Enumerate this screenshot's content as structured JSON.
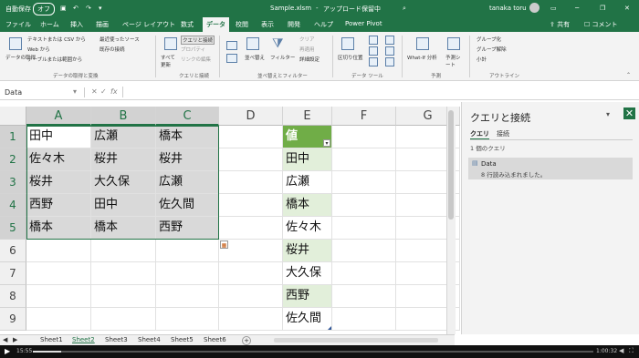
{
  "titlebar": {
    "autosave_label": "自動保存",
    "autosave_state": "オフ",
    "filename": "Sample.xlsm",
    "status": "アップロード保留中",
    "user": "tanaka toru"
  },
  "tabs": [
    "ファイル",
    "ホーム",
    "挿入",
    "描画",
    "ページ レイアウト",
    "数式",
    "データ",
    "校閲",
    "表示",
    "開発",
    "ヘルプ",
    "Power Pivot"
  ],
  "active_tab": "データ",
  "share_label": "共有",
  "comment_label": "コメント",
  "ribbon": {
    "get_data_label": "データの取得",
    "get_data_items": [
      "テキストまたは CSV から",
      "Web から",
      "テーブルまたは範囲から"
    ],
    "recent_items": [
      "最近使ったソース",
      "既存の接続"
    ],
    "group_get": "データの取得と変換",
    "refresh_label": "すべて更新",
    "conn_items": [
      "クエリと接続",
      "プロパティ",
      "リンクの編集"
    ],
    "group_query": "クエリと接続",
    "sort_label": "並べ替え",
    "filter_label": "フィルター",
    "filter_items": [
      "クリア",
      "再適用",
      "詳細設定"
    ],
    "group_sort": "並べ替えとフィルター",
    "split_label": "区切り位置",
    "group_tools": "データ ツール",
    "whatif_label": "What-If 分析",
    "forecast_label": "予測シート",
    "group_forecast": "予測",
    "outline_items": [
      "グループ化",
      "グループ解除",
      "小計"
    ],
    "group_outline": "アウトライン"
  },
  "namebox": "Data",
  "fx_label": "fx",
  "columns": [
    "A",
    "B",
    "C",
    "D",
    "E",
    "F",
    "G"
  ],
  "rows": [
    "1",
    "2",
    "3",
    "4",
    "5",
    "6",
    "7",
    "8",
    "9"
  ],
  "cells": {
    "A": [
      "田中",
      "佐々木",
      "桜井",
      "西野",
      "橋本"
    ],
    "B": [
      "広瀬",
      "桜井",
      "大久保",
      "田中",
      "橋本"
    ],
    "C": [
      "橋本",
      "桜井",
      "広瀬",
      "佐久間",
      "西野"
    ],
    "E": [
      "値",
      "田中",
      "広瀬",
      "橋本",
      "佐々木",
      "桜井",
      "大久保",
      "西野",
      "佐久間"
    ]
  },
  "sheets": [
    "Sheet1",
    "Sheet2",
    "Sheet3",
    "Sheet4",
    "Sheet5",
    "Sheet6"
  ],
  "active_sheet": "Sheet2",
  "pane": {
    "title": "クエリと接続",
    "tabs": [
      "クエリ",
      "接続"
    ],
    "count": "1 個のクエリ",
    "query_name": "Data",
    "query_desc": "8 行読み込まれました。"
  },
  "video": {
    "elapsed": "15:55",
    "duration": "1:00:32",
    "progress": 0.05
  },
  "colors": {
    "excel_green": "#217346",
    "table_header": "#70ad47",
    "table_band": "#e2efda",
    "selection": "#d9d9d9"
  }
}
